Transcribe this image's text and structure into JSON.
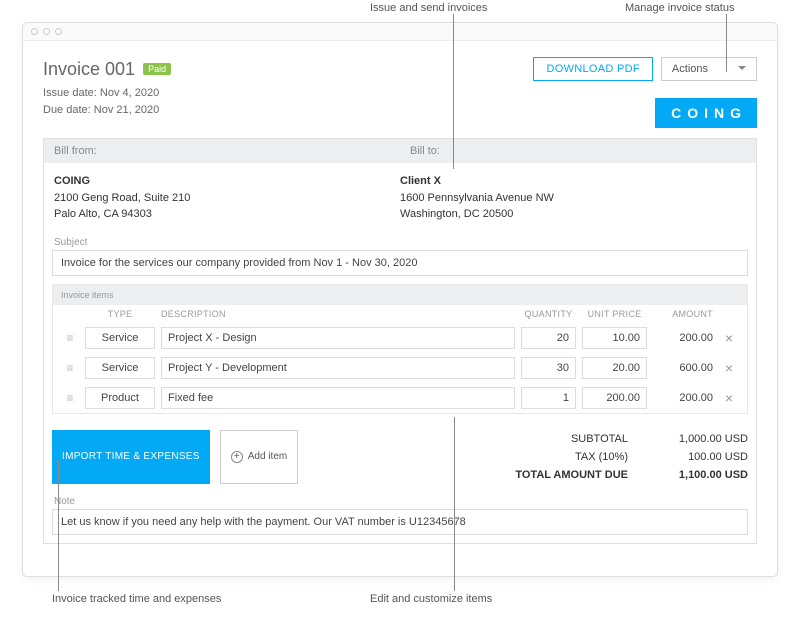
{
  "annotations": {
    "issue_send": "Issue and send invoices",
    "manage_status": "Manage invoice status",
    "invoice_tracked": "Invoice tracked time and expenses",
    "edit_customize": "Edit and customize items"
  },
  "header": {
    "title": "Invoice 001",
    "badge": "Paid",
    "download": "DOWNLOAD PDF",
    "actions": "Actions",
    "issue_date_label": "Issue date:",
    "issue_date": "Nov 4, 2020",
    "due_date_label": "Due date:",
    "due_date": "Nov 21, 2020",
    "logo": "COING"
  },
  "bill": {
    "from_label": "Bill from:",
    "to_label": "Bill to:",
    "from": {
      "name": "COING",
      "line1": "2100 Geng Road, Suite 210",
      "line2": "Palo Alto, CA 94303"
    },
    "to": {
      "name": "Client X",
      "line1": "1600 Pennsylvania Avenue NW",
      "line2": "Washington, DC 20500"
    }
  },
  "subject": {
    "label": "Subject",
    "value": "Invoice for the services our company provided from Nov 1 - Nov 30, 2020"
  },
  "items": {
    "header": "Invoice items",
    "cols": {
      "type": "TYPE",
      "description": "DESCRIPTION",
      "quantity": "QUANTITY",
      "unit_price": "UNIT PRICE",
      "amount": "AMOUNT"
    },
    "rows": [
      {
        "type": "Service",
        "description": "Project X - Design",
        "quantity": "20",
        "unit_price": "10.00",
        "amount": "200.00"
      },
      {
        "type": "Service",
        "description": "Project Y - Development",
        "quantity": "30",
        "unit_price": "20.00",
        "amount": "600.00"
      },
      {
        "type": "Product",
        "description": "Fixed fee",
        "quantity": "1",
        "unit_price": "200.00",
        "amount": "200.00"
      }
    ]
  },
  "buttons": {
    "import": "IMPORT TIME & EXPENSES",
    "add_item": "Add item"
  },
  "totals": {
    "subtotal_label": "SUBTOTAL",
    "subtotal": "1,000.00 USD",
    "tax_label": "TAX  (10%)",
    "tax": "100.00 USD",
    "due_label": "TOTAL AMOUNT DUE",
    "due": "1,100.00 USD"
  },
  "note": {
    "label": "Note",
    "value": "Let us know if you need any help with the payment. Our VAT number is U12345678"
  }
}
